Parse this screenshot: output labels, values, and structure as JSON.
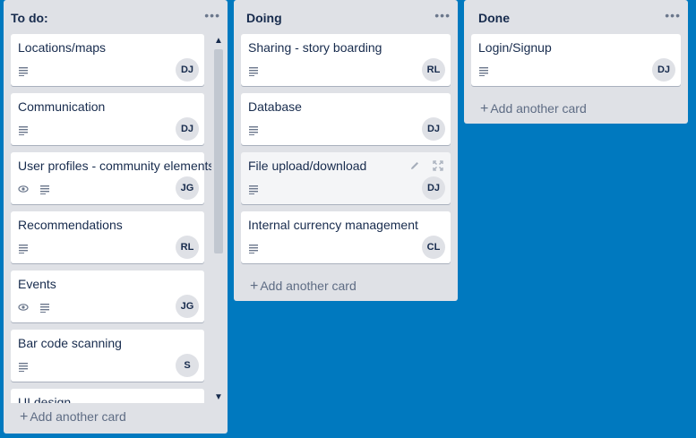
{
  "colors": {
    "board_bg": "#0079bf",
    "list_bg": "#dfe1e6",
    "card_bg": "#ffffff"
  },
  "lists": [
    {
      "title": "To do:",
      "menu": "•••",
      "add_label": "Add another card",
      "cards": [
        {
          "title": "Locations/maps",
          "icons": [
            "description-icon"
          ],
          "member": "DJ"
        },
        {
          "title": "Communication",
          "icons": [
            "description-icon"
          ],
          "member": "DJ"
        },
        {
          "title": "User profiles - community elements",
          "icons": [
            "watch-icon",
            "description-icon"
          ],
          "member": "JG"
        },
        {
          "title": "Recommendations",
          "icons": [
            "description-icon"
          ],
          "member": "RL"
        },
        {
          "title": "Events",
          "icons": [
            "watch-icon",
            "description-icon"
          ],
          "member": "JG"
        },
        {
          "title": "Bar code scanning",
          "icons": [
            "description-icon"
          ],
          "member": "S"
        },
        {
          "title": "UI design",
          "icons": [],
          "member": ""
        }
      ]
    },
    {
      "title": "Doing",
      "menu": "•••",
      "add_label": "Add another card",
      "cards": [
        {
          "title": "Sharing - story boarding",
          "icons": [
            "description-icon"
          ],
          "member": "RL"
        },
        {
          "title": "Database",
          "icons": [
            "description-icon"
          ],
          "member": "DJ"
        },
        {
          "title": "File upload/download",
          "icons": [
            "description-icon"
          ],
          "member": "DJ",
          "hover_actions": [
            "edit-icon",
            "expand-icon"
          ]
        },
        {
          "title": "Internal currency management",
          "icons": [
            "description-icon"
          ],
          "member": "CL"
        }
      ]
    },
    {
      "title": "Done",
      "menu": "•••",
      "add_label": "Add another card",
      "cards": [
        {
          "title": "Login/Signup",
          "icons": [
            "description-icon"
          ],
          "member": "DJ"
        }
      ]
    }
  ]
}
